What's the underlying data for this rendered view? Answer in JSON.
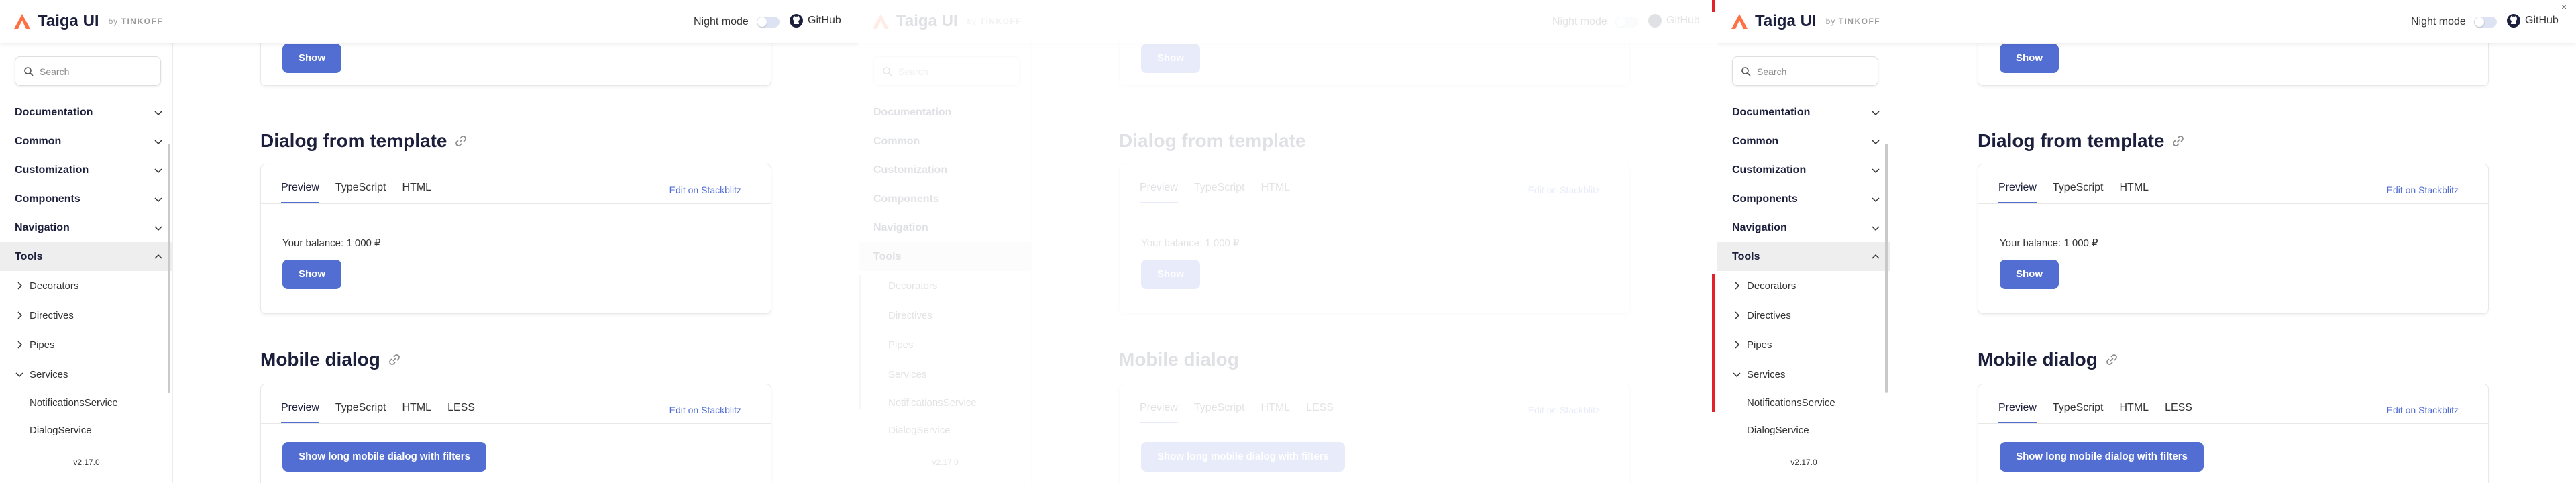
{
  "header": {
    "logo_text": "Taiga UI",
    "logo_by": "by",
    "logo_company": "TINKOFF",
    "night_mode_label": "Night mode",
    "github_label": "GitHub"
  },
  "sidebar": {
    "search_placeholder": "Search",
    "sections": [
      {
        "label": "Documentation"
      },
      {
        "label": "Common"
      },
      {
        "label": "Customization"
      },
      {
        "label": "Components"
      },
      {
        "label": "Navigation"
      },
      {
        "label": "Tools"
      }
    ],
    "tools_children": [
      {
        "label": "Decorators"
      },
      {
        "label": "Directives"
      },
      {
        "label": "Pipes"
      },
      {
        "label": "Services"
      }
    ],
    "services_children": [
      {
        "label": "NotificationsService"
      },
      {
        "label": "DialogService"
      }
    ],
    "version": "v2.17.0"
  },
  "main": {
    "top_button": "Show",
    "section1": {
      "title": "Dialog from template",
      "tabs": [
        "Preview",
        "TypeScript",
        "HTML"
      ],
      "edit_link": "Edit on Stackblitz",
      "balance_text": "Your balance: 1 000 ₽",
      "button": "Show"
    },
    "section2": {
      "title": "Mobile dialog",
      "tabs": [
        "Preview",
        "TypeScript",
        "HTML",
        "LESS"
      ],
      "edit_link": "Edit on Stackblitz",
      "button": "Show long mobile dialog with filters"
    }
  },
  "colors": {
    "accent": "#526ed3",
    "logo_orange": "#ff7043",
    "active_bg": "#eeeeee",
    "marker_red": "#e2212b"
  }
}
